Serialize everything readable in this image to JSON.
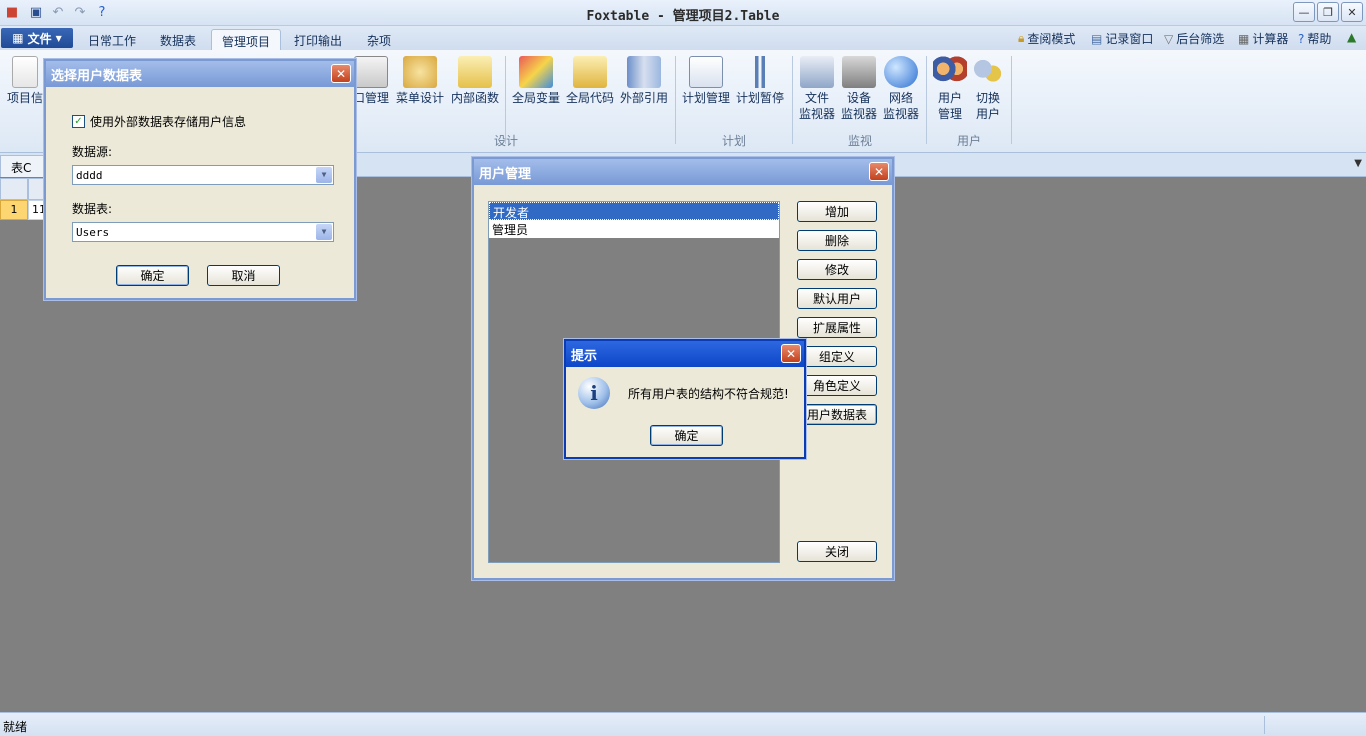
{
  "window": {
    "title": "Foxtable - 管理项目2.Table",
    "quick_access": [
      "app-icon",
      "save-icon",
      "undo-icon",
      "redo-icon",
      "help-icon"
    ]
  },
  "tabs": {
    "file_label": "文件",
    "items": [
      "日常工作",
      "数据表",
      "管理项目",
      "打印输出",
      "杂项"
    ],
    "active": "管理项目"
  },
  "right_tools": {
    "view_mode": "查阅模式",
    "record_window": "记录窗口",
    "bg_filter": "后台筛选",
    "calculator": "计算器",
    "help": "帮助"
  },
  "ribbon": {
    "project_info": "项目信",
    "window_mgmt": "口管理",
    "menu_design": "菜单设计",
    "internal_func": "内部函数",
    "global_var": "全局变量",
    "global_code": "全局代码",
    "external_ref": "外部引用",
    "plan_mgmt": "计划管理",
    "plan_pause": "计划暂停",
    "file_monitor_1": "文件",
    "file_monitor_2": "监视器",
    "device_monitor_1": "设备",
    "device_monitor_2": "监视器",
    "net_monitor_1": "网络",
    "net_monitor_2": "监视器",
    "user_mgmt_1": "用户",
    "user_mgmt_2": "管理",
    "switch_user_1": "切换",
    "switch_user_2": "用户",
    "group_design": "设计",
    "group_plan": "计划",
    "group_monitor": "监视",
    "group_user": "用户"
  },
  "table_strip": {
    "tab": "表C"
  },
  "grid": {
    "row_number": "1",
    "cell_value": "11"
  },
  "status": {
    "text": "就绪"
  },
  "dlg_select": {
    "title": "选择用户数据表",
    "use_external_label": "使用外部数据表存储用户信息",
    "use_external_checked": true,
    "datasource_label": "数据源:",
    "datasource_value": "dddd",
    "table_label": "数据表:",
    "table_value": "Users",
    "ok": "确定",
    "cancel": "取消"
  },
  "dlg_users": {
    "title": "用户管理",
    "list": [
      "开发者",
      "管理员"
    ],
    "selected_index": 0,
    "buttons": {
      "add": "增加",
      "delete": "删除",
      "modify": "修改",
      "default_user": "默认用户",
      "ext_props": "扩展属性",
      "group_def": "组定义",
      "role_def": "角色定义",
      "user_table": "用户数据表",
      "close": "关闭"
    }
  },
  "dlg_prompt": {
    "title": "提示",
    "message": "所有用户表的结构不符合规范!",
    "ok": "确定",
    "icon": "info-icon"
  }
}
